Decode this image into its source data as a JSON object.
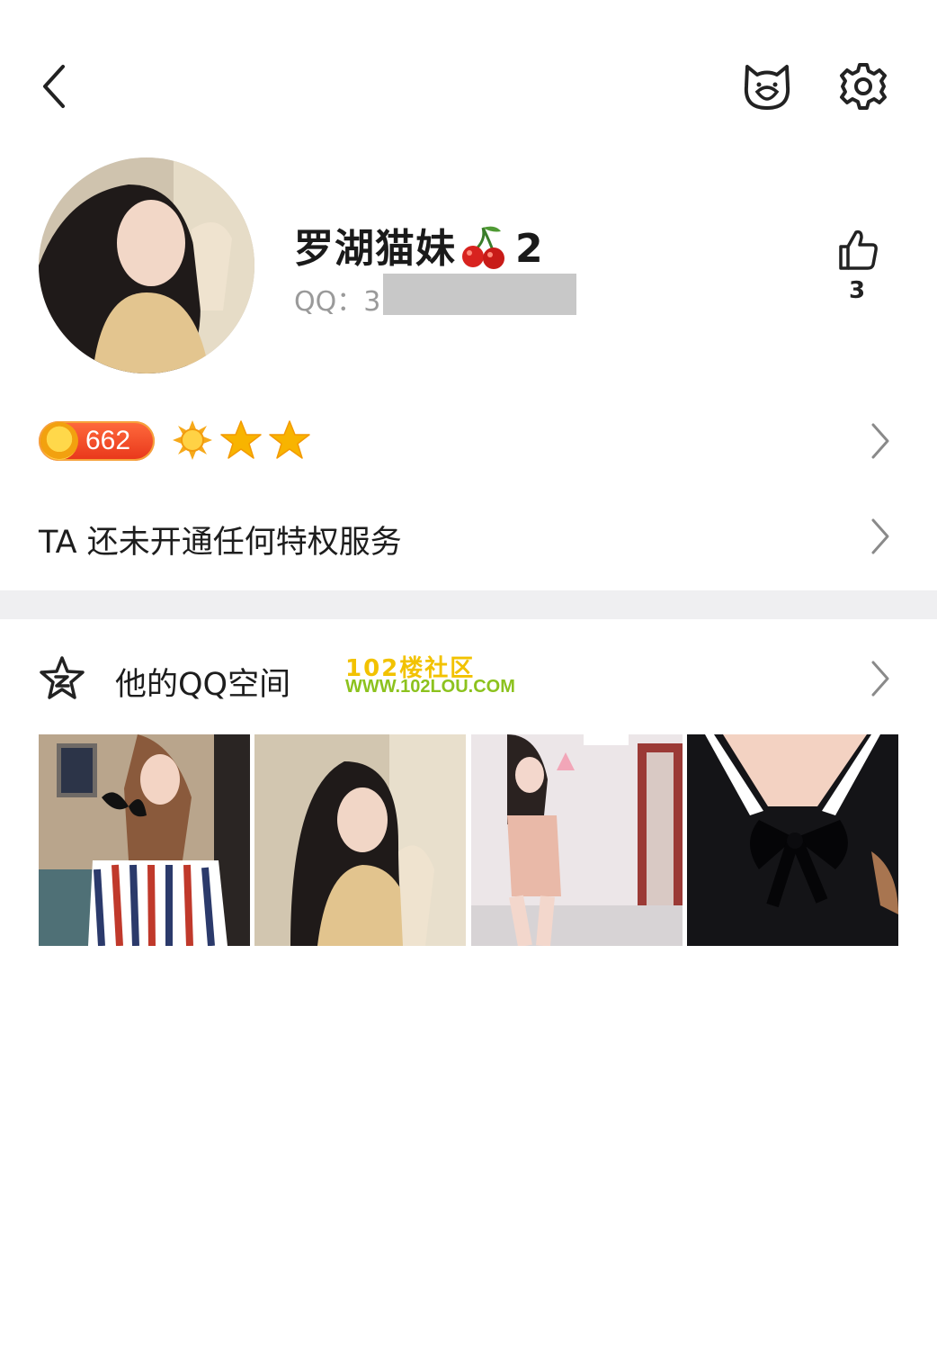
{
  "header": {
    "back_icon": "chevron-left-icon",
    "right_icons": [
      "cat-face-icon",
      "gear-icon"
    ]
  },
  "profile": {
    "nickname": "罗湖猫妹",
    "nickname_emoji": "cherry-icon",
    "nickname_suffix": "2",
    "qq_label": "QQ：3",
    "like_count": "3"
  },
  "level": {
    "value": "662",
    "icons": [
      "sun-icon",
      "star-icon",
      "star-icon"
    ]
  },
  "privilege": {
    "text": "TA 还未开通任何特权服务"
  },
  "qzone": {
    "title": "他的QQ空间",
    "watermark_line1": "102楼社区",
    "watermark_line2": "WWW.102LOU.COM",
    "photos": [
      "photo-1",
      "photo-2",
      "photo-3",
      "photo-4"
    ]
  },
  "colors": {
    "badge": "#e8361a",
    "star": "#f7b500",
    "divider": "#efeff1",
    "muted_text": "#9a9a9a"
  }
}
